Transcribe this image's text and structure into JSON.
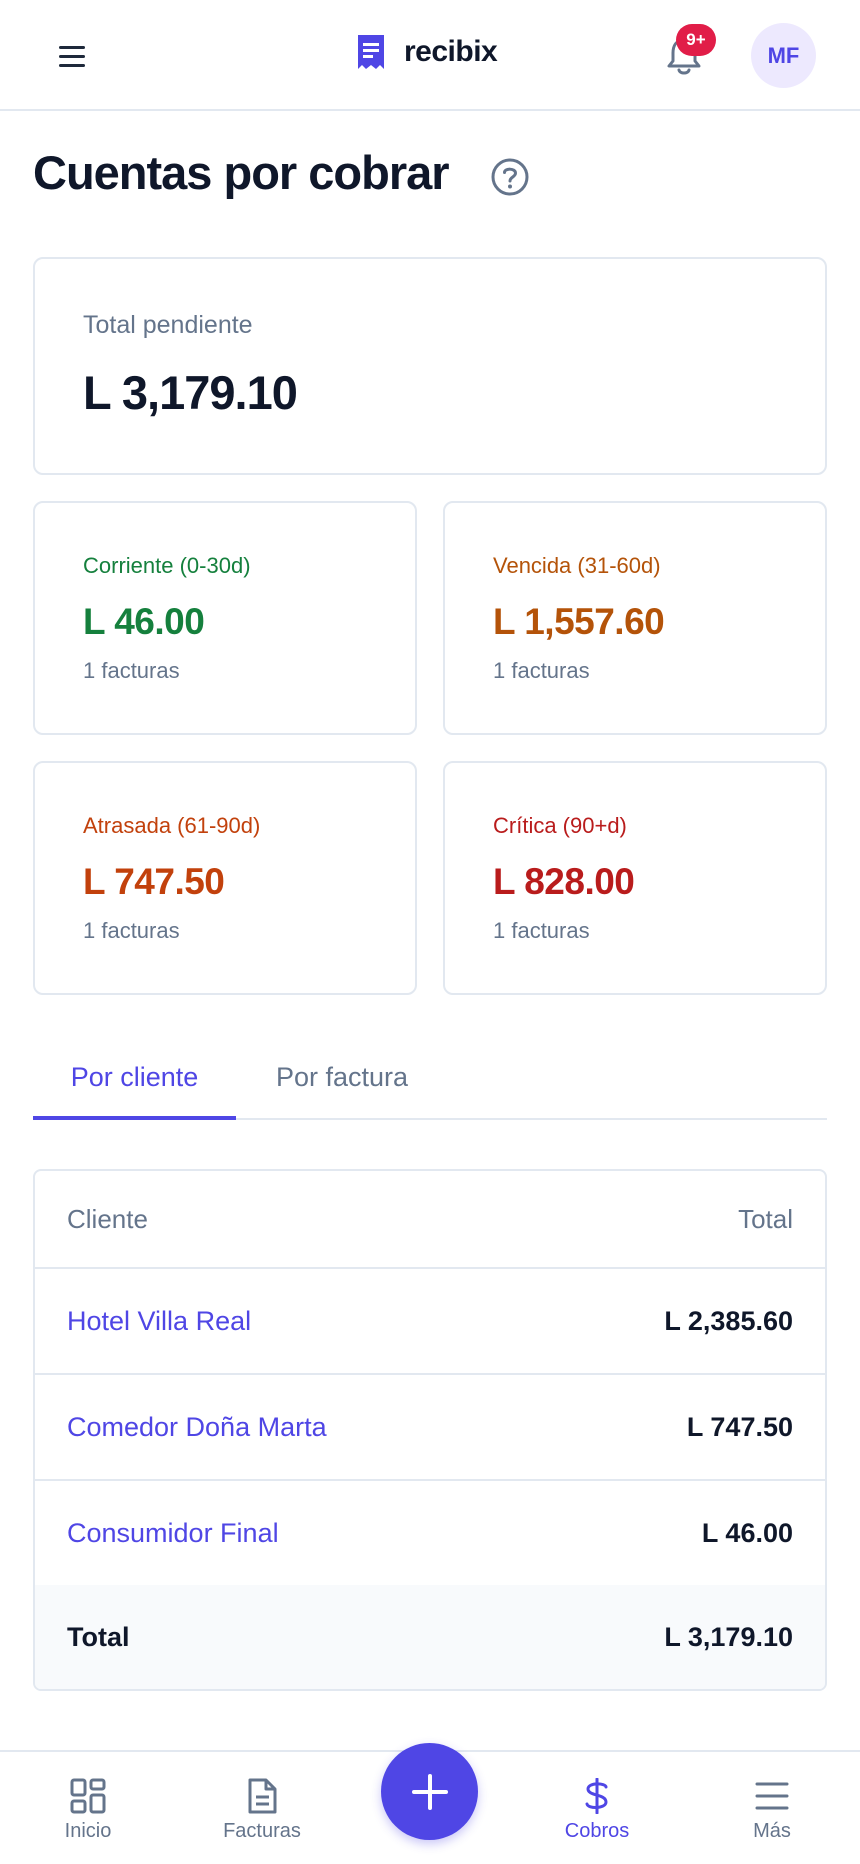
{
  "header": {
    "brand_name": "recibix",
    "notifications_badge": "9+",
    "avatar_initials": "MF"
  },
  "page": {
    "title": "Cuentas por cobrar"
  },
  "summary": {
    "total_label": "Total pendiente",
    "total_value": "L 3,179.10"
  },
  "aging": [
    {
      "label": "Corriente (0-30d)",
      "value": "L 46.00",
      "count": "1 facturas",
      "color": "#15803d"
    },
    {
      "label": "Vencida (31-60d)",
      "value": "L 1,557.60",
      "count": "1 facturas",
      "color": "#b45309"
    },
    {
      "label": "Atrasada (61-90d)",
      "value": "L 747.50",
      "count": "1 facturas",
      "color": "#c2410c"
    },
    {
      "label": "Crítica (90+d)",
      "value": "L 828.00",
      "count": "1 facturas",
      "color": "#b91c1c"
    }
  ],
  "tabs": [
    {
      "label": "Por cliente",
      "active": true
    },
    {
      "label": "Por factura",
      "active": false
    }
  ],
  "table": {
    "headers": {
      "client": "Cliente",
      "total": "Total"
    },
    "rows": [
      {
        "client": "Hotel Villa Real",
        "amount": "L 2,385.60"
      },
      {
        "client": "Comedor Doña Marta",
        "amount": "L 747.50"
      },
      {
        "client": "Consumidor Final",
        "amount": "L 46.00"
      }
    ],
    "footer": {
      "label": "Total",
      "amount": "L 3,179.10"
    }
  },
  "bottom_nav": [
    {
      "label": "Inicio",
      "icon": "grid-icon"
    },
    {
      "label": "Facturas",
      "icon": "document-icon"
    },
    {
      "label": "Cobros",
      "icon": "dollar-icon",
      "active": true
    },
    {
      "label": "Más",
      "icon": "menu-icon"
    }
  ],
  "colors": {
    "accent": "#4f46e5",
    "badge": "#e11d48"
  }
}
